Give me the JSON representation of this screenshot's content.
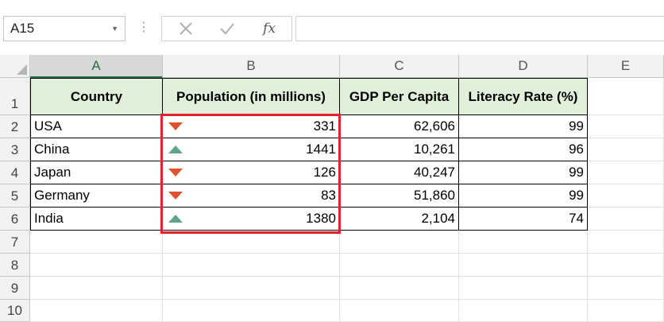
{
  "formula_bar": {
    "name_box": "A15",
    "formula_value": "",
    "cancel_icon": "close-icon",
    "enter_icon": "check-icon",
    "fx_label": "fx"
  },
  "columns": [
    "A",
    "B",
    "C",
    "D",
    "E"
  ],
  "rows": [
    "1",
    "2",
    "3",
    "4",
    "5",
    "6",
    "7",
    "8",
    "9",
    "10"
  ],
  "table": {
    "headers": [
      "Country",
      "Population (in millions)",
      "GDP Per Capita",
      "Literacy Rate (%)"
    ],
    "data": [
      {
        "country": "USA",
        "population": "331",
        "trend": "down",
        "gdp": "62,606",
        "literacy": "99"
      },
      {
        "country": "China",
        "population": "1441",
        "trend": "up",
        "gdp": "10,261",
        "literacy": "96"
      },
      {
        "country": "Japan",
        "population": "126",
        "trend": "down",
        "gdp": "40,247",
        "literacy": "99"
      },
      {
        "country": "Germany",
        "population": "83",
        "trend": "down",
        "gdp": "51,860",
        "literacy": "99"
      },
      {
        "country": "India",
        "population": "1380",
        "trend": "up",
        "gdp": "2,104",
        "literacy": "74"
      }
    ]
  },
  "colors": {
    "header_fill": "#e2efda",
    "trend_down": "#e0512e",
    "trend_up": "#5fa388",
    "highlight_border": "#e3232c"
  }
}
